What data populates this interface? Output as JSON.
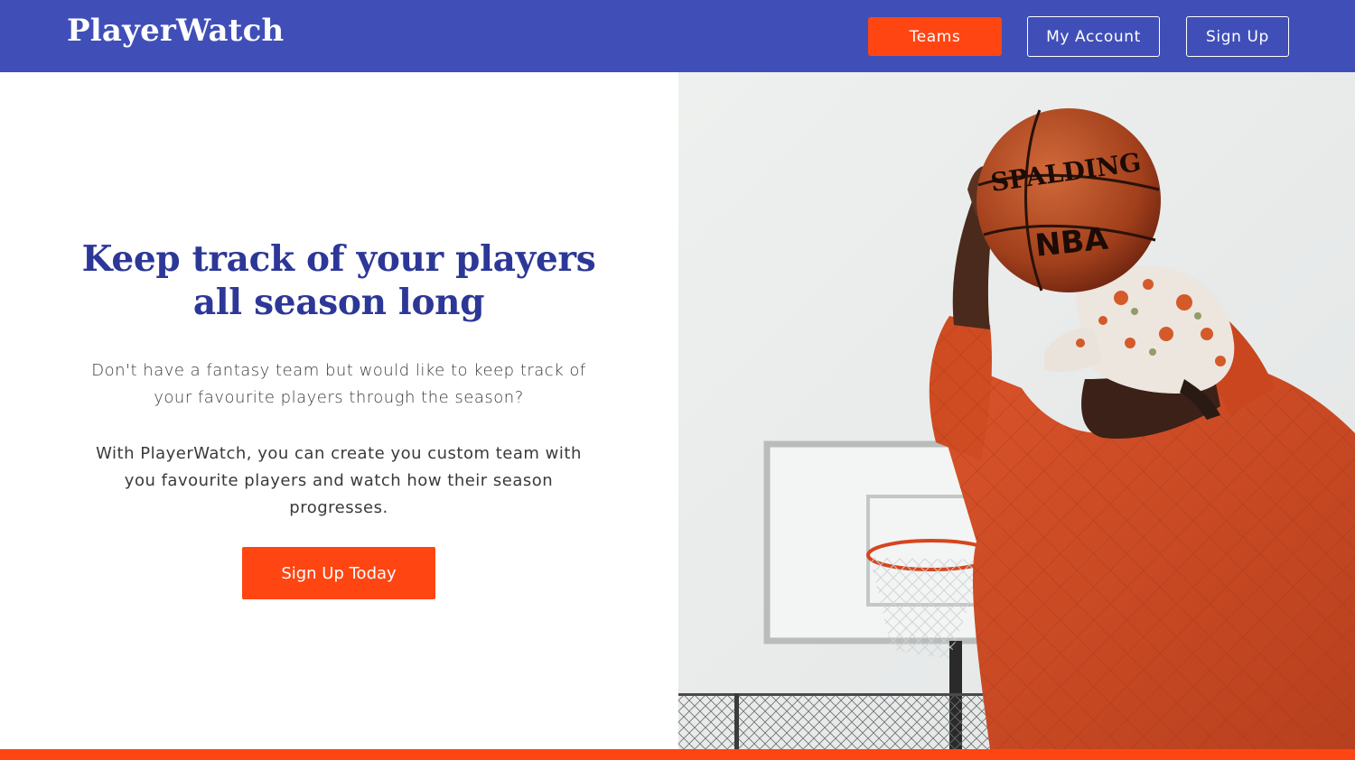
{
  "brand": {
    "name": "PlayerWatch"
  },
  "nav": {
    "teams_label": "Teams",
    "account_label": "My Account",
    "signup_label": "Sign Up"
  },
  "hero": {
    "title": "Keep track of your players all season long",
    "paragraph1": "Don't have a fantasy team but would like to keep track of your favourite players through the season?",
    "paragraph2": "With PlayerWatch, you can create you custom team with you favourite players and watch how their season progresses.",
    "cta_label": "Sign Up Today",
    "ball_brand": "SPALDING",
    "ball_league": "NBA"
  },
  "colors": {
    "nav_background": "#404fb8",
    "accent": "#ff4512",
    "heading": "#2c3797",
    "body_text": "#3a3a3a"
  }
}
